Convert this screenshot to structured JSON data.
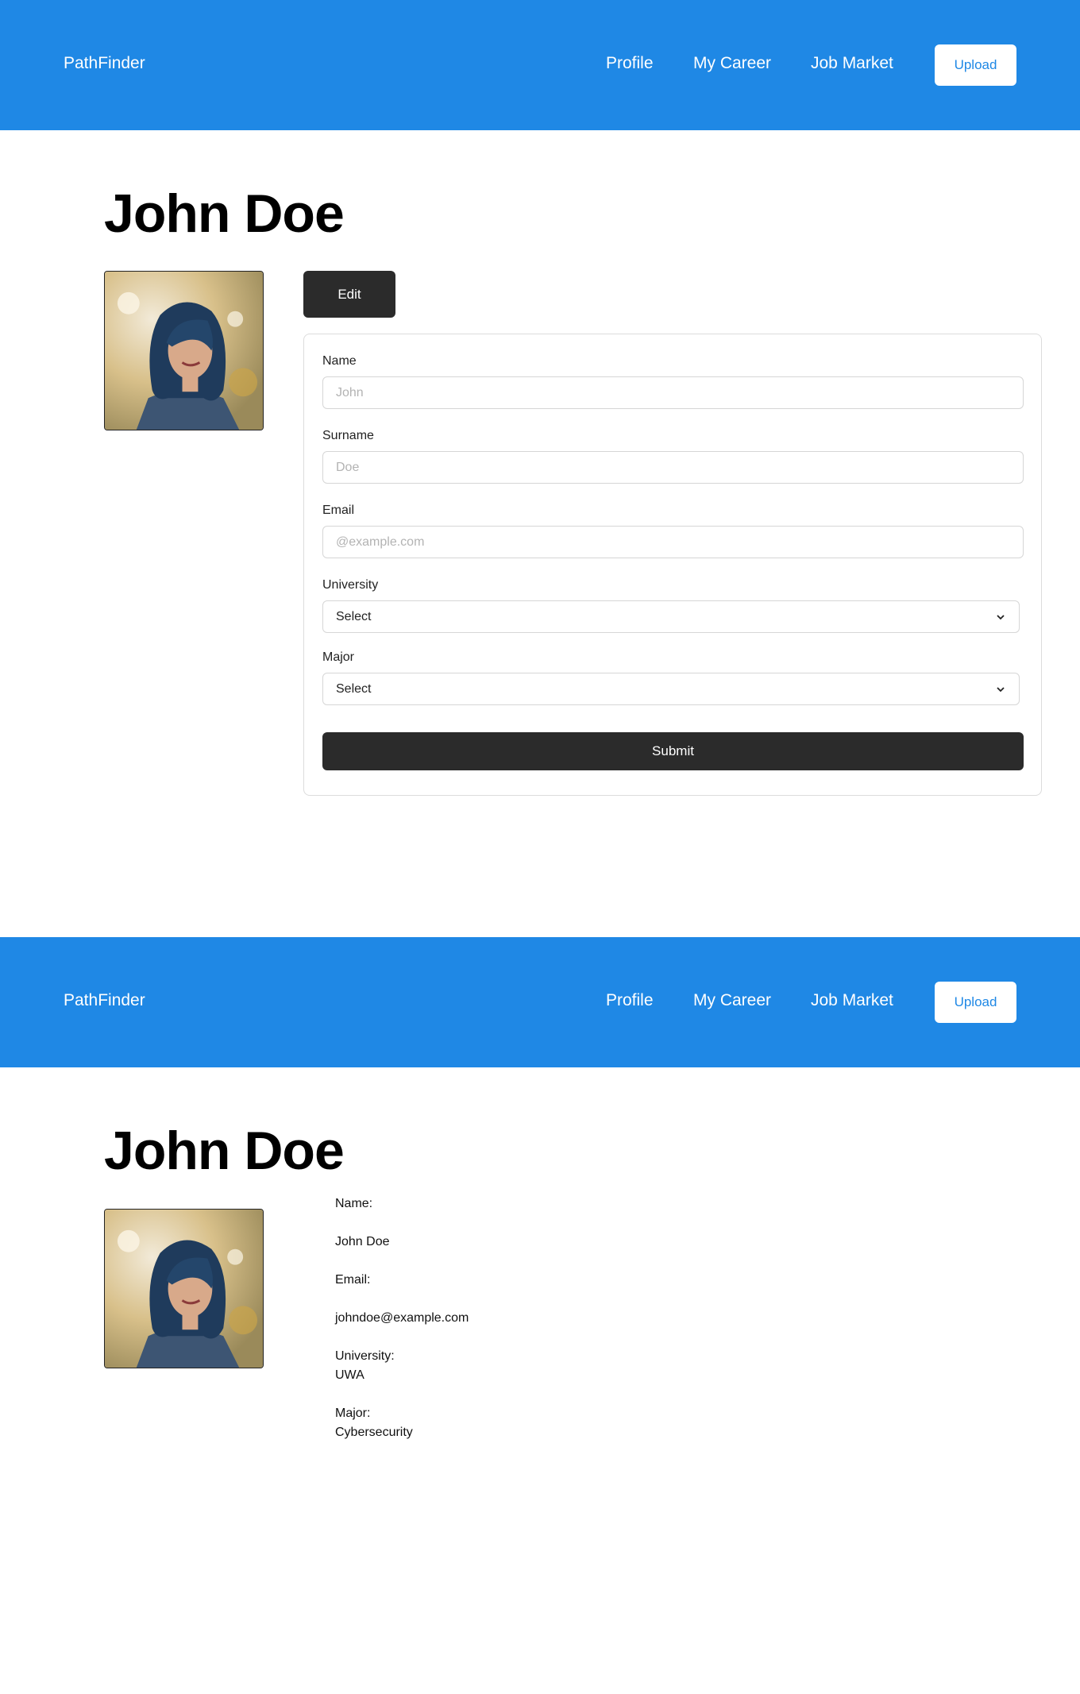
{
  "nav": {
    "brand": "PathFinder",
    "links": [
      "Profile",
      "My Career",
      "Job Market"
    ],
    "upload_label": "Upload"
  },
  "colors": {
    "brand_blue": "#1f88e5",
    "dark_button": "#2b2b2b"
  },
  "edit_view": {
    "title": "John Doe",
    "edit_label": "Edit",
    "form": {
      "name_label": "Name",
      "name_placeholder": "John",
      "surname_label": "Surname",
      "surname_placeholder": "Doe",
      "email_label": "Email",
      "email_placeholder": "@example.com",
      "university_label": "University",
      "university_value": "Select",
      "major_label": "Major",
      "major_value": "Select",
      "submit_label": "Submit"
    }
  },
  "profile_view": {
    "title": "John Doe",
    "name_label": "Name:",
    "name_value": "John Doe",
    "email_label": "Email:",
    "email_value": "johndoe@example.com",
    "university_label": "University:",
    "university_value": "UWA",
    "major_label": "Major:",
    "major_value": "Cybersecurity"
  }
}
